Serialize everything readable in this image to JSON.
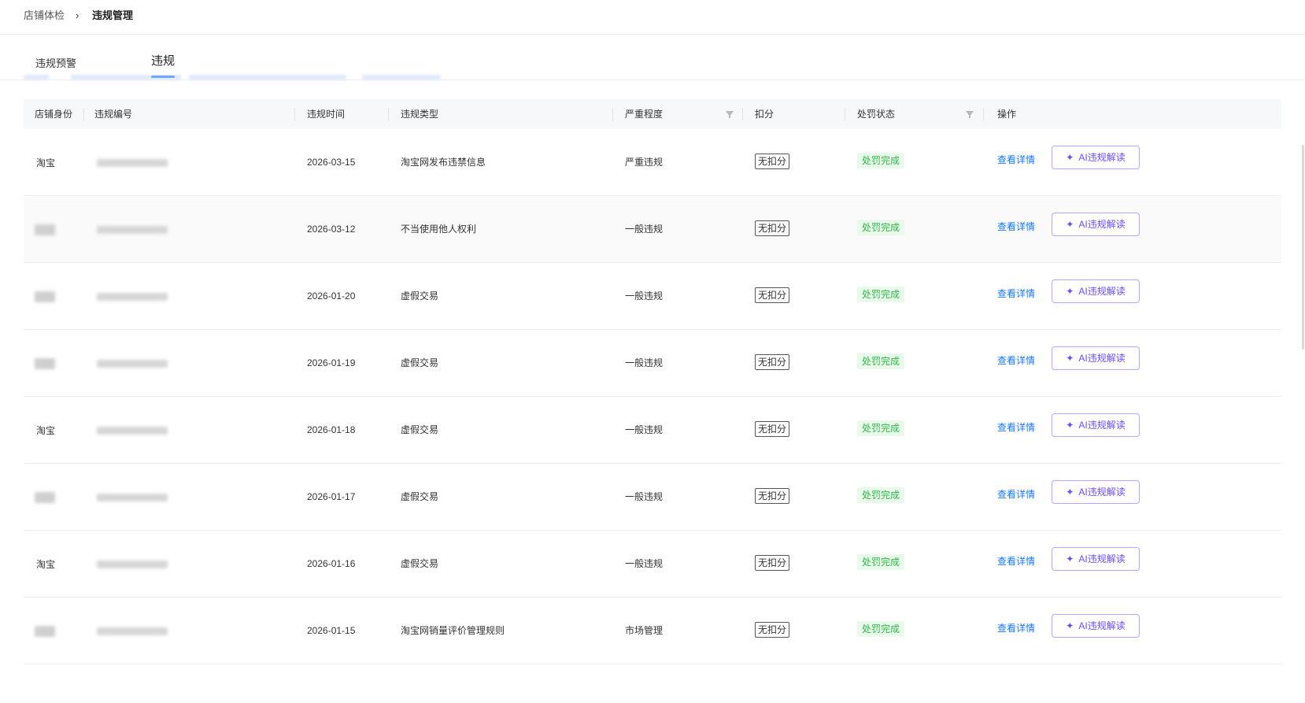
{
  "breadcrumb": {
    "parent": "店铺体检",
    "separator": "›",
    "current": "违规管理"
  },
  "tabs": [
    {
      "label": "违规预警",
      "active": false
    },
    {
      "label": "违规",
      "active": true
    }
  ],
  "table": {
    "columns": {
      "shop": "店铺身份",
      "id": "违规编号",
      "time": "违规时间",
      "type": "违规类型",
      "severity": "严重程度",
      "score": "扣分",
      "status": "处罚状态",
      "ops": "操作"
    },
    "rows": [
      {
        "shop": "淘宝",
        "time": "2026-03-15",
        "type": "淘宝网发布违禁信息",
        "severity": "严重违规",
        "score": "无扣分",
        "status": "处罚完成",
        "link": "查看详情",
        "ai": "AI违规解读"
      },
      {
        "shop": "",
        "time": "2026-03-12",
        "type": "不当使用他人权利",
        "severity": "一般违规",
        "score": "无扣分",
        "status": "处罚完成",
        "link": "查看详情",
        "ai": "AI违规解读"
      },
      {
        "shop": "",
        "time": "2026-01-20",
        "type": "虚假交易",
        "severity": "一般违规",
        "score": "无扣分",
        "status": "处罚完成",
        "link": "查看详情",
        "ai": "AI违规解读"
      },
      {
        "shop": "",
        "time": "2026-01-19",
        "type": "虚假交易",
        "severity": "一般违规",
        "score": "无扣分",
        "status": "处罚完成",
        "link": "查看详情",
        "ai": "AI违规解读"
      },
      {
        "shop": "淘宝",
        "time": "2026-01-18",
        "type": "虚假交易",
        "severity": "一般违规",
        "score": "无扣分",
        "status": "处罚完成",
        "link": "查看详情",
        "ai": "AI违规解读"
      },
      {
        "shop": "",
        "time": "2026-01-17",
        "type": "虚假交易",
        "severity": "一般违规",
        "score": "无扣分",
        "status": "处罚完成",
        "link": "查看详情",
        "ai": "AI违规解读"
      },
      {
        "shop": "淘宝",
        "time": "2026-01-16",
        "type": "虚假交易",
        "severity": "一般违规",
        "score": "无扣分",
        "status": "处罚完成",
        "link": "查看详情",
        "ai": "AI违规解读"
      },
      {
        "shop": "",
        "time": "2026-01-15",
        "type": "淘宝网销量评价管理规则",
        "severity": "市场管理",
        "score": "无扣分",
        "status": "处罚完成",
        "link": "查看详情",
        "ai": "AI违规解读"
      }
    ]
  },
  "colors": {
    "link": "#1677ff",
    "status_bg": "#e9f9ea",
    "status_text": "#2eb84b",
    "ai_border": "#b9a5ff",
    "ai_text": "#6a4cff",
    "header_bg": "#f7f8fa"
  },
  "icons": {
    "ai_button": "sparkle-icon",
    "filter": "filter-icon",
    "breadcrumb_sep": "chevron-right-icon"
  }
}
